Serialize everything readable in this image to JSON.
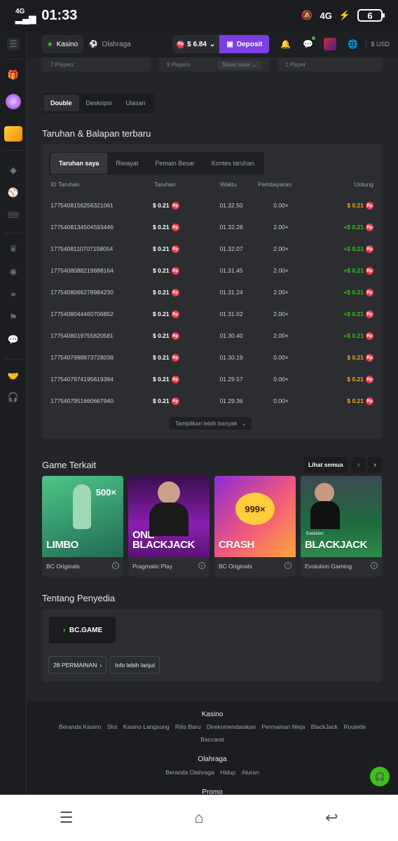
{
  "status_bar": {
    "network": "4G",
    "time": "01:33",
    "battery": "6",
    "network_right": "4G"
  },
  "appbar": {
    "casino_label": "Kasino",
    "sports_label": "Olahraga",
    "balance": "$ 6.84",
    "deposit_label": "Deposit",
    "currency_label": "$ USD"
  },
  "player_cards": {
    "card1": "7 Players",
    "card2": "9 Players",
    "card2_more": "Show more",
    "card3": "1 Player"
  },
  "game_tabs": [
    {
      "label": "Double",
      "active": true
    },
    {
      "label": "Deskripsi",
      "active": false
    },
    {
      "label": "Ulasan",
      "active": false
    }
  ],
  "bets_section": {
    "title": "Taruhan & Balapan terbaru",
    "tabs": [
      {
        "label": "Taruhan saya",
        "active": true
      },
      {
        "label": "Riwayat",
        "active": false
      },
      {
        "label": "Pemain Besar",
        "active": false
      },
      {
        "label": "Kontes taruhan",
        "active": false
      }
    ],
    "columns": {
      "id": "ID Taruhan",
      "bet": "Taruhan",
      "time": "Waktu",
      "payout": "Pembayaran",
      "profit": "Untung"
    },
    "rows": [
      {
        "id": "1775408156256321061",
        "bet": "$ 0.21",
        "time": "01.32.50",
        "payout": "0.00×",
        "profit": "$ 0.21",
        "win": false
      },
      {
        "id": "1775408134504593446",
        "bet": "$ 0.21",
        "time": "01.32.28",
        "payout": "2.00×",
        "profit": "+$ 0.21",
        "win": true
      },
      {
        "id": "1775408110707158054",
        "bet": "$ 0.21",
        "time": "01.32.07",
        "payout": "2.00×",
        "profit": "+$ 0.21",
        "win": true
      },
      {
        "id": "1775408088219888164",
        "bet": "$ 0.21",
        "time": "01.31.45",
        "payout": "2.00×",
        "profit": "+$ 0.21",
        "win": true
      },
      {
        "id": "1775408066278984230",
        "bet": "$ 0.21",
        "time": "01.31.24",
        "payout": "2.00×",
        "profit": "+$ 0.21",
        "win": true
      },
      {
        "id": "1775408044460706852",
        "bet": "$ 0.21",
        "time": "01.31.02",
        "payout": "2.00×",
        "profit": "+$ 0.21",
        "win": true
      },
      {
        "id": "1775408019755820581",
        "bet": "$ 0.21",
        "time": "01.30.40",
        "payout": "2.00×",
        "profit": "+$ 0.21",
        "win": true
      },
      {
        "id": "1775407998873728038",
        "bet": "$ 0.21",
        "time": "01.30.19",
        "payout": "0.00×",
        "profit": "$ 0.21",
        "win": false
      },
      {
        "id": "1775407974195619364",
        "bet": "$ 0.21",
        "time": "01.29.57",
        "payout": "0.00×",
        "profit": "$ 0.21",
        "win": false
      },
      {
        "id": "1775407951660667940",
        "bet": "$ 0.21",
        "time": "01.29.36",
        "payout": "0.00×",
        "profit": "$ 0.21",
        "win": false
      }
    ],
    "show_more": "Tampilkan lebih banyak",
    "coin_label": "Rp"
  },
  "related": {
    "title": "Game Terkait",
    "see_all": "Lihat semua",
    "games": [
      {
        "name": "LIMBO",
        "badge": "500×",
        "provider": "BC Originals"
      },
      {
        "name": "ONE BLACKJACK",
        "provider": "Pragmatic Play"
      },
      {
        "name": "CRASH",
        "badge": "999×",
        "provider": "BC Originals"
      },
      {
        "name": "BLACKJACK",
        "badge": "Evolution",
        "provider": "Evolution Gaming"
      }
    ]
  },
  "provider": {
    "title": "Tentang Penyedia",
    "logo_text": "BC.GAME",
    "games_count": "28 PERMAINAN",
    "more_info": "Info lebih lanjut"
  },
  "footer": {
    "casino_heading": "Kasino",
    "casino_links": [
      "Beranda Kasino",
      "Slot",
      "Kasino Langsung",
      "Rilis Baru",
      "Direkomendasikan",
      "Permainan Meja",
      "BlackJack",
      "Roulette",
      "Baccarat"
    ],
    "sports_heading": "Olahraga",
    "sports_links": [
      "Beranda Olahraga",
      "Hidup",
      "Aturan"
    ],
    "promo_heading": "Promo"
  },
  "colors": {
    "accent": "#7b3fe4",
    "win": "#3bc117",
    "loss": "#f5a623",
    "coin": "#e8394a"
  }
}
